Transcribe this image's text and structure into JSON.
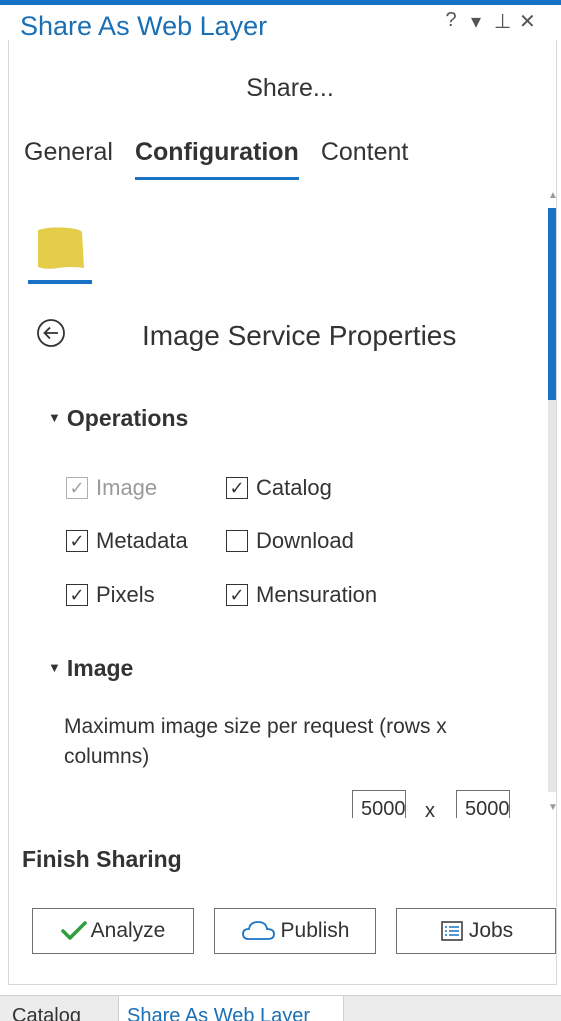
{
  "window": {
    "title": "Share As Web Layer",
    "controls": [
      "?",
      "▾",
      "⊥",
      "✕"
    ]
  },
  "header": {
    "subtitle": "Share..."
  },
  "tabs": [
    {
      "label": "General",
      "active": false
    },
    {
      "label": "Configuration",
      "active": true
    },
    {
      "label": "Content",
      "active": false
    }
  ],
  "layer_tab": {
    "icon": "image-layer-icon",
    "color": "#e3cd4a"
  },
  "section": {
    "title": "Image Service Properties",
    "back_icon": "back-arrow-icon"
  },
  "operations": {
    "heading": "Operations",
    "items": [
      {
        "label": "Image",
        "checked": true,
        "disabled": true
      },
      {
        "label": "Catalog",
        "checked": true,
        "disabled": false
      },
      {
        "label": "Metadata",
        "checked": true,
        "disabled": false
      },
      {
        "label": "Download",
        "checked": false,
        "disabled": false
      },
      {
        "label": "Pixels",
        "checked": true,
        "disabled": false
      },
      {
        "label": "Mensuration",
        "checked": true,
        "disabled": false
      }
    ]
  },
  "image": {
    "heading": "Image",
    "max_size_label": "Maximum image size per request (rows x columns)",
    "rows_value": "5000",
    "separator": "x",
    "cols_value": "5000"
  },
  "finish": {
    "heading": "Finish Sharing",
    "analyze_label": "Analyze",
    "publish_label": "Publish",
    "jobs_label": "Jobs"
  },
  "bottom_tabs": [
    {
      "label": "Catalog",
      "active": false
    },
    {
      "label": "Share As Web Layer",
      "active": true
    }
  ],
  "colors": {
    "accent": "#1a73c6",
    "title": "#1a6fb5",
    "check_green": "#2e9e3e"
  }
}
